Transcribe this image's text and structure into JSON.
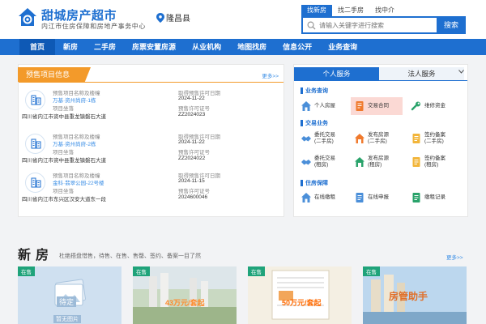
{
  "header": {
    "logo_title": "甜城房产超市",
    "logo_subtitle": "内江市住房保障和房地产事务中心",
    "location": "隆昌县",
    "search_tabs": [
      "找新房",
      "找二手房",
      "找中介"
    ],
    "search_placeholder": "请输入关键字进行搜索",
    "search_button": "搜索"
  },
  "nav": {
    "items": [
      "首页",
      "新房",
      "二手房",
      "房票安置房源",
      "从业机构",
      "地图找房",
      "信息公开",
      "业务查询"
    ]
  },
  "presale": {
    "title": "预售项目信息",
    "more": "更多>>",
    "projects": [
      {
        "label_name": "预售项目名称及楼幢",
        "name": "万基·资州尚府-1栋",
        "label_date": "取得预售许可日期",
        "date": "2024-11-22",
        "label_location": "项目坐落",
        "location": "四川省内江市资中县重龙镇磐石大道",
        "label_permit": "预售许可证号",
        "permit": "ZZ2024023"
      },
      {
        "label_name": "预售项目名称及楼幢",
        "name": "万基·资州尚府-2栋",
        "label_date": "取得预售许可日期",
        "date": "2024-11-22",
        "label_location": "项目坐落",
        "location": "四川省内江市资中县重龙镇磐石大道",
        "label_permit": "预售许可证号",
        "permit": "ZZ2024022"
      },
      {
        "label_name": "预售项目名称及楼幢",
        "name": "金科·翡翠公园-22号楼",
        "label_date": "取得预售许可日期",
        "date": "2024-11-15",
        "label_location": "项目坐落",
        "location": "四川省内江市东兴区汉安大道东一段",
        "label_permit": "预售许可证号",
        "permit": "2024600046"
      }
    ]
  },
  "service": {
    "tabs": [
      "个人服务",
      "法人服务"
    ],
    "sections": [
      {
        "title": "业务查询",
        "items": [
          "个人房屋",
          "交易合同",
          "维修资金"
        ]
      },
      {
        "title": "交易业务",
        "items": [
          "委托交易\n(二手房)",
          "发布房源\n(二手房)",
          "签约备案\n(二手房)",
          "委托交易\n(租房)",
          "发布房源\n(租房)",
          "签约备案\n(租房)"
        ]
      },
      {
        "title": "住房保障",
        "items": [
          "在线缴租",
          "在线申报",
          "缴租记录"
        ]
      }
    ]
  },
  "new_homes": {
    "title": "新房",
    "subtitle": "杜绝捂盘惜售，待售、在售、售罄、签约、备案一目了然",
    "more": "更多>>",
    "cards": [
      {
        "badge": "在售",
        "overlay": "待定",
        "overlay2": "暂无图片"
      },
      {
        "badge": "在售",
        "overlay": "43万元/套起"
      },
      {
        "badge": "在售",
        "overlay": "50万元/套起"
      },
      {
        "badge": "在售",
        "overlay": "房管助手"
      }
    ]
  },
  "colors": {
    "primary": "#1e6fd0",
    "accent_orange": "#f39a2a",
    "badge_green": "#1fa37a",
    "highlight": "#fbd9d4"
  }
}
